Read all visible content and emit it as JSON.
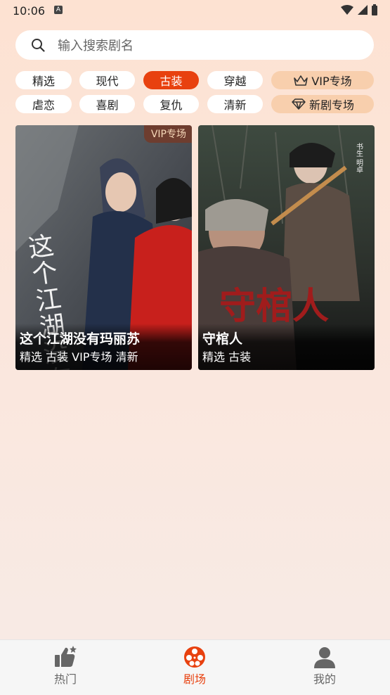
{
  "status": {
    "time": "10:06"
  },
  "search": {
    "placeholder": "输入搜索剧名"
  },
  "categories": [
    {
      "label": "精选"
    },
    {
      "label": "现代"
    },
    {
      "label": "古装",
      "selected": true
    },
    {
      "label": "穿越"
    },
    {
      "label": "VIP专场",
      "icon": "crown-icon"
    },
    {
      "label": "虐恋"
    },
    {
      "label": "喜剧"
    },
    {
      "label": "复仇"
    },
    {
      "label": "清新"
    },
    {
      "label": "新剧专场",
      "icon": "diamond-icon"
    }
  ],
  "dramas": [
    {
      "title": "这个江湖没有玛丽苏",
      "tags": "精选 古装 VIP专场 清新",
      "badge": "VIP专场",
      "poster_text": "这个江湖没有玛丽苏"
    },
    {
      "title": "守棺人",
      "tags": "精选 古装",
      "poster_text": "守棺人",
      "poster_subtext": "书生 明卓"
    }
  ],
  "tabbar": [
    {
      "label": "热门",
      "icon": "thumbs-up-icon"
    },
    {
      "label": "剧场",
      "icon": "film-reel-icon",
      "active": true
    },
    {
      "label": "我的",
      "icon": "user-icon"
    }
  ],
  "colors": {
    "accent": "#e8410f",
    "vip": "#f8cfad"
  }
}
